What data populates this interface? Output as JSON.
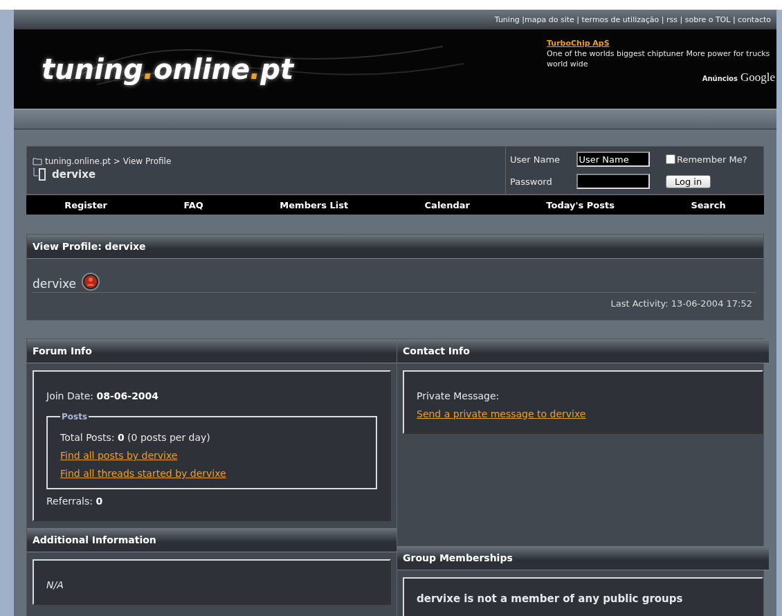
{
  "top_links": "Tuning |mapa do site | termos de utilização | rss | sobre o TOL | contacto",
  "banner": {
    "logo_parts": [
      {
        "text": "tuning",
        "accent": false
      },
      {
        "text": ".",
        "accent": true
      },
      {
        "text": "online",
        "accent": false
      },
      {
        "text": ".",
        "accent": true
      },
      {
        "text": "pt",
        "accent": false
      }
    ],
    "ad": {
      "title": "TurboChip ApS",
      "body": "One of the worlds biggest chiptuner More power for trucks world wide",
      "ads_label": "Anúncios",
      "ads_brand": "Google"
    }
  },
  "breadcrumb": {
    "path": "tuning.online.pt > View Profile",
    "current": "dervixe"
  },
  "login": {
    "username_label": "User Name",
    "username_value": "User Name",
    "password_label": "Password",
    "remember": {
      "label": "Remember Me?",
      "checked": false
    },
    "button": "Log in"
  },
  "nav": [
    "Register",
    "FAQ",
    "Members List",
    "Calendar",
    "Today's Posts",
    "Search"
  ],
  "profile": {
    "title": "View Profile: dervixe",
    "username": "dervixe",
    "online": false,
    "last_activity": "Last Activity: 13-06-2004 17:52"
  },
  "forum_info": {
    "title": "Forum Info",
    "join_label": "Join Date:",
    "join_value": "08-06-2004",
    "posts_legend": "Posts",
    "total_label": "Total Posts:",
    "total_value": "0",
    "per_day": "(0 posts per day)",
    "links": [
      "Find all posts by dervixe",
      "Find all threads started by dervixe"
    ],
    "referrals_label": "Referrals:",
    "referrals_value": "0"
  },
  "contact_info": {
    "title": "Contact Info",
    "pm_label": "Private Message:",
    "pm_link": "Send a private message to dervixe"
  },
  "additional_info": {
    "title": "Additional Information",
    "text": "N/A"
  },
  "group_memberships": {
    "title": "Group Memberships",
    "text": "dervixe is not a member of any public groups"
  }
}
